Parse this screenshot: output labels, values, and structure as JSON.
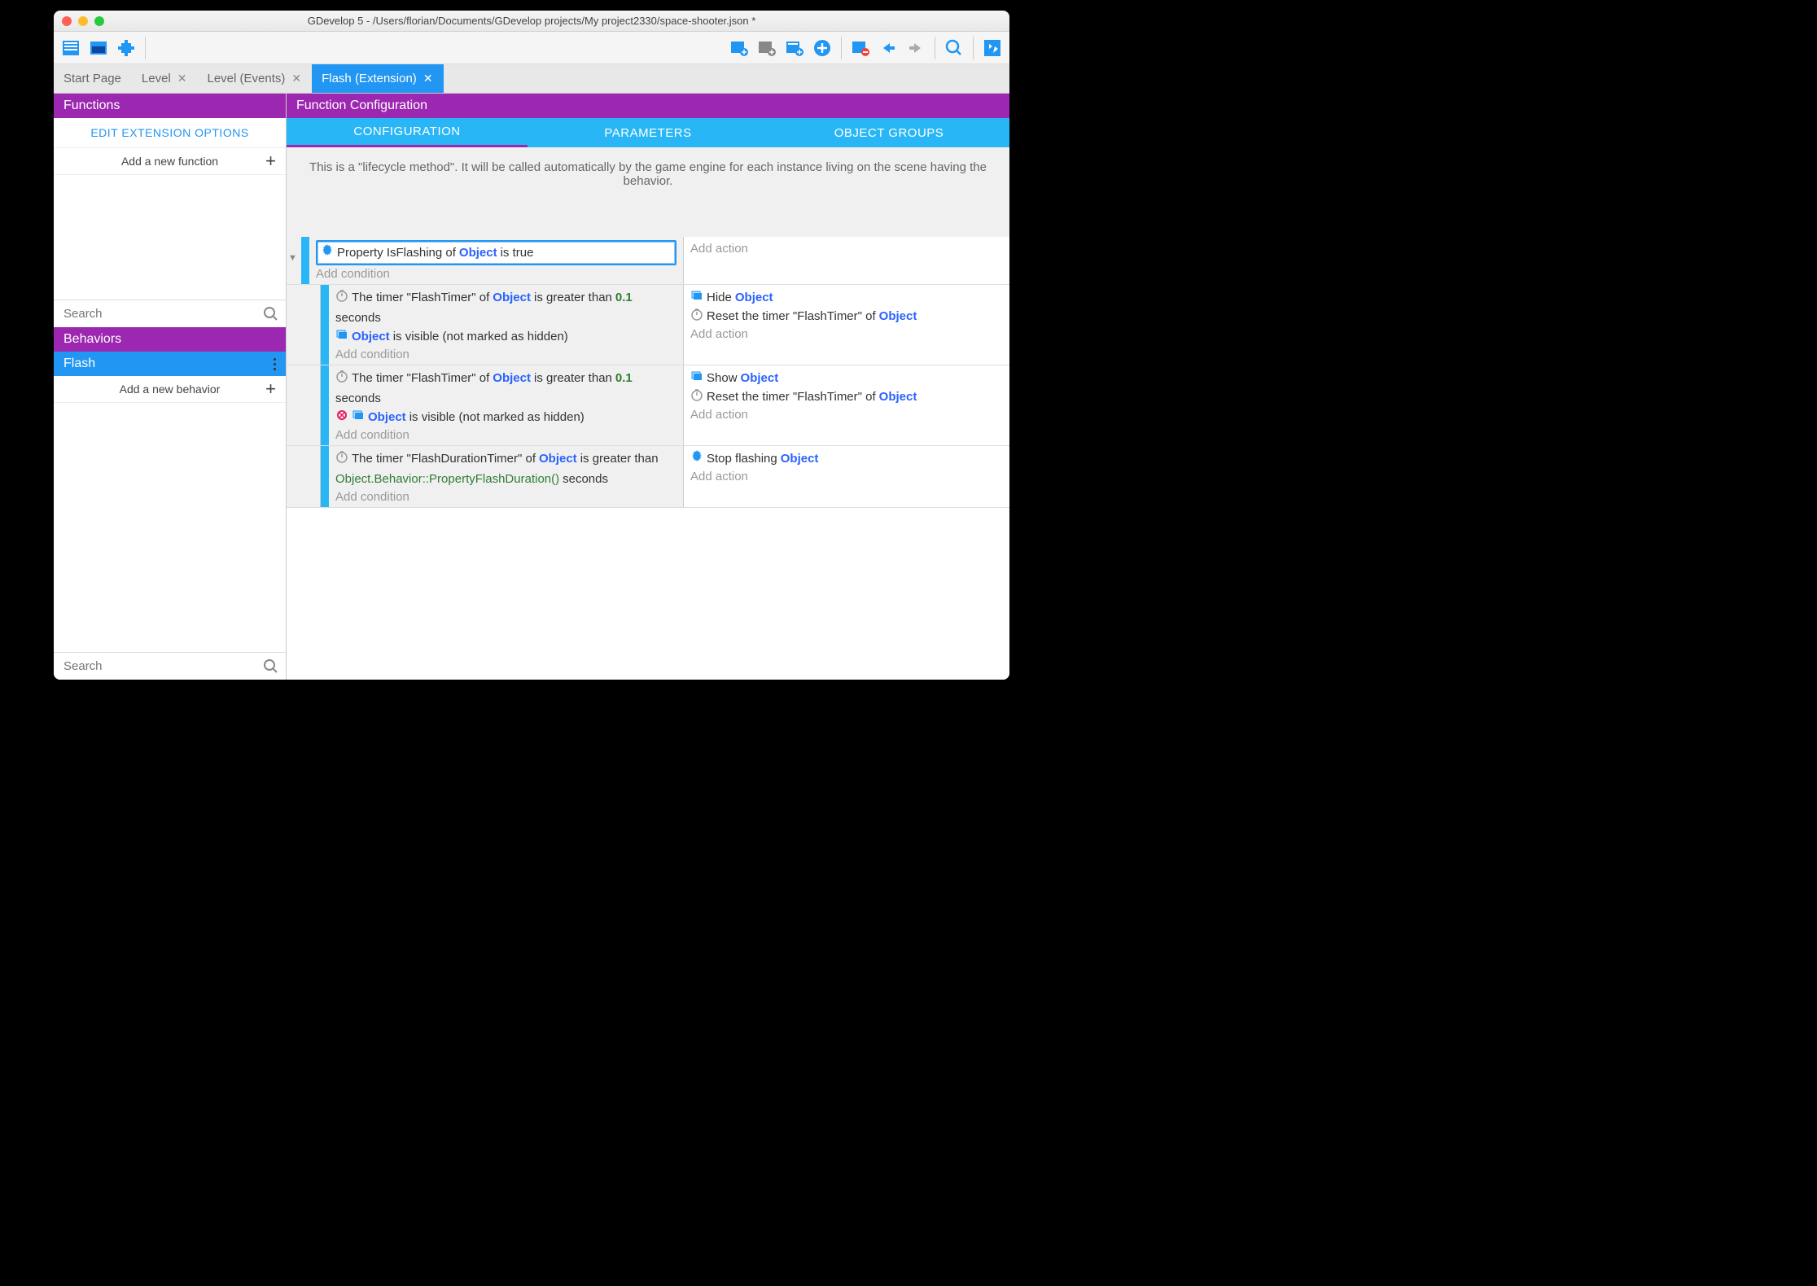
{
  "window_title": "GDevelop 5 - /Users/florian/Documents/GDevelop projects/My project2330/space-shooter.json *",
  "tabs": [
    {
      "label": "Start Page",
      "closable": false
    },
    {
      "label": "Level",
      "closable": true
    },
    {
      "label": "Level (Events)",
      "closable": true
    },
    {
      "label": "Flash (Extension)",
      "closable": true,
      "active": true
    }
  ],
  "sidebar": {
    "functions_header": "Functions",
    "edit_options": "EDIT EXTENSION OPTIONS",
    "add_function": "Add a new function",
    "search_placeholder": "Search",
    "behaviors_header": "Behaviors",
    "behavior_item": "Flash",
    "add_behavior": "Add a new behavior",
    "search2_placeholder": "Search"
  },
  "main": {
    "header": "Function Configuration",
    "config_tabs": [
      "CONFIGURATION",
      "PARAMETERS",
      "OBJECT GROUPS"
    ],
    "description": "This is a \"lifecycle method\". It will be called automatically by the game engine for each instance living on the scene having the behavior."
  },
  "events": [
    {
      "indent": 0,
      "selected": true,
      "conditions": [
        {
          "icon": "gear",
          "text": "Property IsFlashing of ",
          "obj": "Object",
          "rest": " is true"
        }
      ],
      "add_cond": "Add condition",
      "actions": [],
      "add_act": "Add action",
      "children": [
        {
          "indent": 1,
          "conditions": [
            {
              "icon": "timer",
              "text": "The timer \"FlashTimer\" of ",
              "obj": "Object",
              "rest": " is greater than ",
              "num": "0.1",
              "rest2": " seconds"
            },
            {
              "icon": "layer",
              "obj": "Object",
              "rest": " is visible (not marked as hidden)"
            }
          ],
          "add_cond": "Add condition",
          "actions": [
            {
              "icon": "layer",
              "text": "Hide ",
              "obj": "Object"
            },
            {
              "icon": "timer",
              "text": "Reset the timer \"FlashTimer\" of ",
              "obj": "Object"
            }
          ],
          "add_act": "Add action"
        },
        {
          "indent": 1,
          "conditions": [
            {
              "icon": "timer",
              "text": "The timer \"FlashTimer\" of ",
              "obj": "Object",
              "rest": " is greater than ",
              "num": "0.1",
              "rest2": " seconds"
            },
            {
              "icon": "not",
              "icon2": "layer",
              "obj": "Object",
              "rest": " is visible (not marked as hidden)"
            }
          ],
          "add_cond": "Add condition",
          "actions": [
            {
              "icon": "layer",
              "text": "Show ",
              "obj": "Object"
            },
            {
              "icon": "timer",
              "text": "Reset the timer \"FlashTimer\" of ",
              "obj": "Object"
            }
          ],
          "add_act": "Add action"
        },
        {
          "indent": 1,
          "conditions": [
            {
              "icon": "timer",
              "text": "The timer \"FlashDurationTimer\" of ",
              "obj": "Object",
              "rest": " is greater than ",
              "expr": "Object.Behavior::PropertyFlashDuration()",
              "rest2": " seconds"
            }
          ],
          "add_cond": "Add condition",
          "actions": [
            {
              "icon": "gear",
              "text": "Stop flashing ",
              "obj": "Object"
            }
          ],
          "add_act": "Add action"
        }
      ]
    }
  ]
}
